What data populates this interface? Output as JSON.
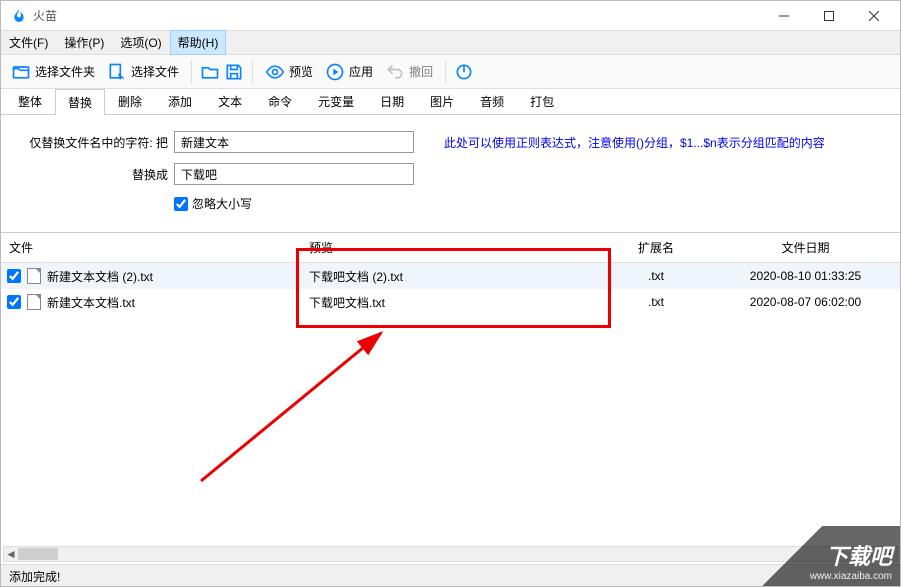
{
  "window": {
    "title": "火苗"
  },
  "menus": {
    "file": "文件(F)",
    "operate": "操作(P)",
    "options": "选项(O)",
    "help": "帮助(H)"
  },
  "toolbar": {
    "select_folder": "选择文件夹",
    "select_file": "选择文件",
    "preview": "预览",
    "apply": "应用",
    "undo": "撤回"
  },
  "tabs": {
    "whole": "整体",
    "replace": "替换",
    "delete": "删除",
    "add": "添加",
    "text": "文本",
    "command": "命令",
    "metavar": "元变量",
    "date": "日期",
    "image": "图片",
    "audio": "音频",
    "package": "打包"
  },
  "form": {
    "replace_label": "仅替换文件名中的字符: 把",
    "replace_value": "新建文本",
    "with_label": "替换成",
    "with_value": "下载吧",
    "hint": "此处可以使用正则表达式，注意使用()分组，$1...$n表示分组匹配的内容",
    "ignore_case": "忽略大小写"
  },
  "columns": {
    "file": "文件",
    "preview": "预览",
    "ext": "扩展名",
    "date": "文件日期"
  },
  "rows": [
    {
      "checked": true,
      "name": "新建文本文档 (2).txt",
      "preview": "下载吧文档 (2).txt",
      "ext": ".txt",
      "date": "2020-08-10 01:33:25"
    },
    {
      "checked": true,
      "name": "新建文本文档.txt",
      "preview": "下载吧文档.txt",
      "ext": ".txt",
      "date": "2020-08-07 06:02:00"
    }
  ],
  "status": "添加完成!",
  "watermark": {
    "brand": "下载吧",
    "url": "www.xiazaiba.com"
  }
}
